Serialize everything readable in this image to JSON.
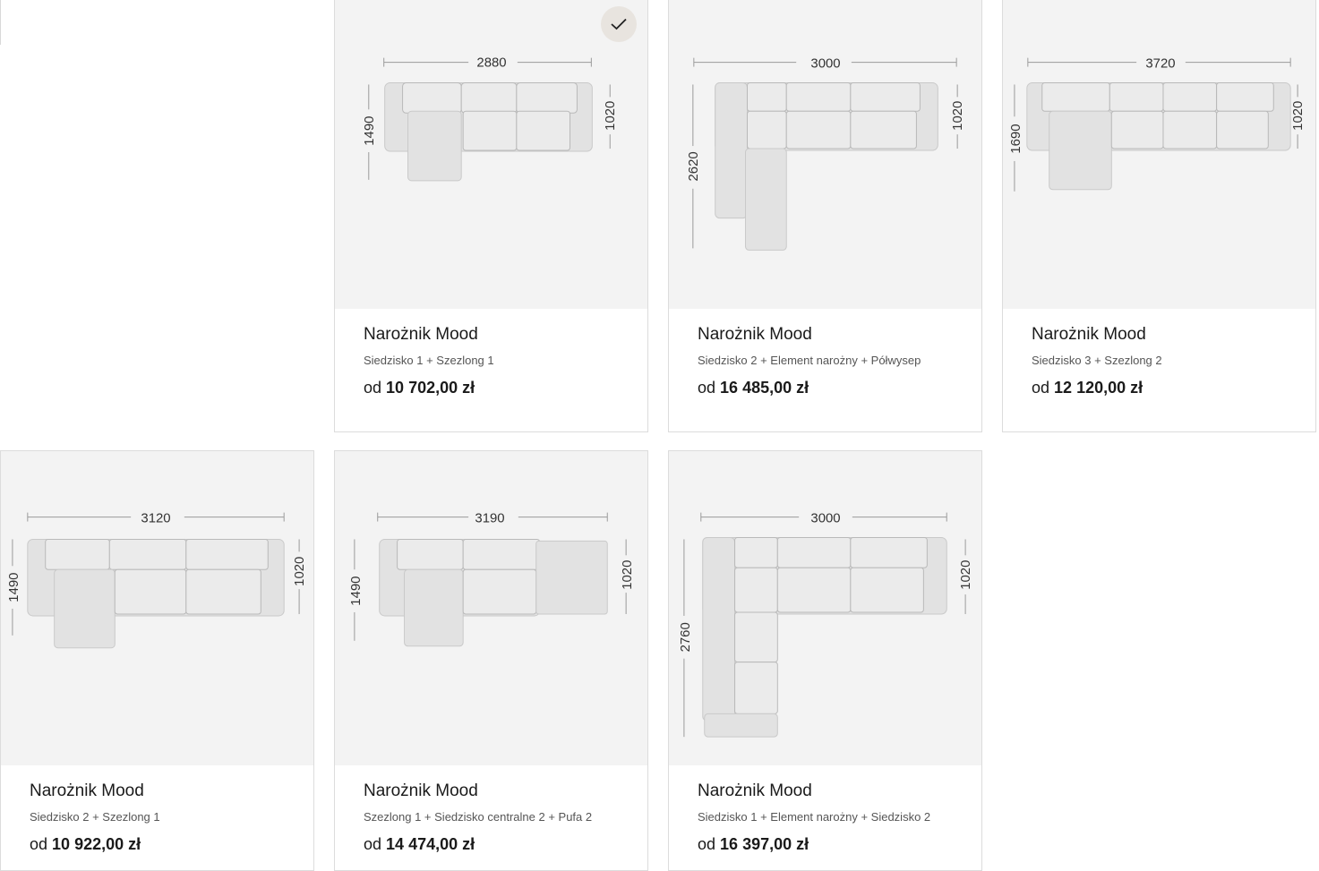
{
  "products": [
    {
      "name": "Narożnik Mood",
      "config": "Siedzisko 1 + Szezlong 1",
      "price_prefix": "od",
      "price": "10 702,00 zł",
      "selected": true,
      "dims": {
        "width": "2880",
        "left": "1490",
        "right": "1020"
      }
    },
    {
      "name": "Narożnik Mood",
      "config": "Siedzisko 2 + Element narożny + Półwysep",
      "price_prefix": "od",
      "price": "16 485,00 zł",
      "selected": false,
      "dims": {
        "width": "3000",
        "left": "2620",
        "right": "1020"
      }
    },
    {
      "name": "Narożnik Mood",
      "config": "Siedzisko 3 + Szezlong 2",
      "price_prefix": "od",
      "price": "12 120,00 zł",
      "selected": false,
      "dims": {
        "width": "3720",
        "left": "1690",
        "right": "1020"
      }
    },
    {
      "name": "Narożnik Mood",
      "config": "Siedzisko 2 + Szezlong 1",
      "price_prefix": "od",
      "price": "10 922,00 zł",
      "selected": false,
      "dims": {
        "width": "3120",
        "left": "1490",
        "right": "1020"
      }
    },
    {
      "name": "Narożnik Mood",
      "config": "Szezlong 1 + Siedzisko centralne 2 + Pufa 2",
      "price_prefix": "od",
      "price": "14 474,00 zł",
      "selected": false,
      "dims": {
        "width": "3190",
        "left": "1490",
        "right": "1020"
      }
    },
    {
      "name": "Narożnik Mood",
      "config": "Siedzisko 1 + Element narożny + Siedzisko 2",
      "price_prefix": "od",
      "price": "16 397,00 zł",
      "selected": false,
      "dims": {
        "width": "3000",
        "left": "2760",
        "right": "1020"
      }
    }
  ],
  "icons": {
    "selected_badge": "check-icon"
  }
}
